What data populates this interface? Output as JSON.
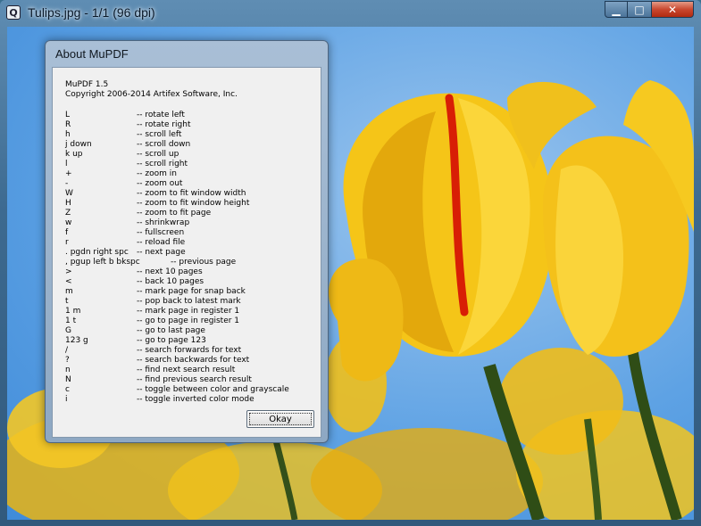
{
  "window": {
    "title": "Tulips.jpg - 1/1 (96 dpi)",
    "app_icon_glyph": "Q",
    "controls": {
      "minimize": "▁",
      "maximize": "□",
      "close": "✕"
    }
  },
  "dialog": {
    "title": "About MuPDF",
    "version": "MuPDF 1.5",
    "copyright": "Copyright 2006-2014 Artifex Software, Inc.",
    "ok_label": "Okay",
    "keys": [
      {
        "key": "L",
        "desc": "-- rotate left"
      },
      {
        "key": "R",
        "desc": "-- rotate right"
      },
      {
        "key": "h",
        "desc": "-- scroll left"
      },
      {
        "key": "j down",
        "desc": "-- scroll down"
      },
      {
        "key": "k up",
        "desc": "-- scroll up"
      },
      {
        "key": "l",
        "desc": "-- scroll right"
      },
      {
        "key": "+",
        "desc": "-- zoom in"
      },
      {
        "key": "-",
        "desc": "-- zoom out"
      },
      {
        "key": "W",
        "desc": "-- zoom to fit window width"
      },
      {
        "key": "H",
        "desc": "-- zoom to fit window height"
      },
      {
        "key": "Z",
        "desc": "-- zoom to fit page"
      },
      {
        "key": "w",
        "desc": "-- shrinkwrap"
      },
      {
        "key": "f",
        "desc": "-- fullscreen"
      },
      {
        "key": "r",
        "desc": "-- reload file"
      },
      {
        "key": ". pgdn right spc",
        "desc": "-- next page"
      },
      {
        "key": ", pgup left b bkspc",
        "desc": "-- previous page"
      },
      {
        "key": ">",
        "desc": "-- next 10 pages"
      },
      {
        "key": "<",
        "desc": "-- back 10 pages"
      },
      {
        "key": "m",
        "desc": "-- mark page for snap back"
      },
      {
        "key": "t",
        "desc": "-- pop back to latest mark"
      },
      {
        "key": "1 m",
        "desc": "-- mark page in register 1"
      },
      {
        "key": "1 t",
        "desc": "-- go to page in register 1"
      },
      {
        "key": "G",
        "desc": "-- go to last page"
      },
      {
        "key": "123 g",
        "desc": "-- go to page 123"
      },
      {
        "key": "/",
        "desc": "-- search forwards for text"
      },
      {
        "key": "?",
        "desc": "-- search backwards for text"
      },
      {
        "key": "n",
        "desc": "-- find next search result"
      },
      {
        "key": "N",
        "desc": "-- find previous search result"
      },
      {
        "key": "c",
        "desc": "-- toggle between color and grayscale"
      },
      {
        "key": "i",
        "desc": "-- toggle inverted color mode"
      }
    ]
  },
  "colors": {
    "sky": "#5ea2e4",
    "petal": "#f5c518",
    "petal_dark": "#c98a06",
    "stem": "#2f4d16",
    "stripe": "#d81e05"
  }
}
